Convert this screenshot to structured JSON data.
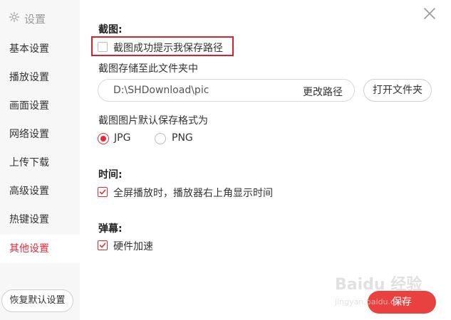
{
  "sidebar": {
    "header": "设置",
    "items": [
      {
        "label": "基本设置",
        "active": false
      },
      {
        "label": "播放设置",
        "active": false
      },
      {
        "label": "画面设置",
        "active": false
      },
      {
        "label": "网络设置",
        "active": false
      },
      {
        "label": "上传下载",
        "active": false
      },
      {
        "label": "高级设置",
        "active": false
      },
      {
        "label": "热键设置",
        "active": false
      },
      {
        "label": "其他设置",
        "active": true
      }
    ],
    "restore_button": "恢复默认设置"
  },
  "screenshot": {
    "title": "截图:",
    "success_prompt_label": "截图成功提示我保存路径",
    "success_prompt_checked": false,
    "folder_label": "截图存储至此文件夹中",
    "path_value": "D:\\SHDownload\\pic",
    "change_path_button": "更改路径",
    "open_folder_button": "打开文件夹",
    "format_label": "截图图片默认保存格式为",
    "formats": [
      {
        "label": "JPG",
        "selected": true
      },
      {
        "label": "PNG",
        "selected": false
      }
    ]
  },
  "time": {
    "title": "时间:",
    "show_time_label": "全屏播放时，播放器右上角显示时间",
    "show_time_checked": true
  },
  "danmaku": {
    "title": "弹幕:",
    "hw_accel_label": "硬件加速",
    "hw_accel_checked": true
  },
  "footer": {
    "save_button": "保存"
  },
  "watermark": {
    "main": "Baidu 经验",
    "sub": "jingyan.baidu.com"
  },
  "colors": {
    "accent": "#e5293a",
    "save_bg": "#e8413f",
    "highlight": "#d9202b"
  }
}
